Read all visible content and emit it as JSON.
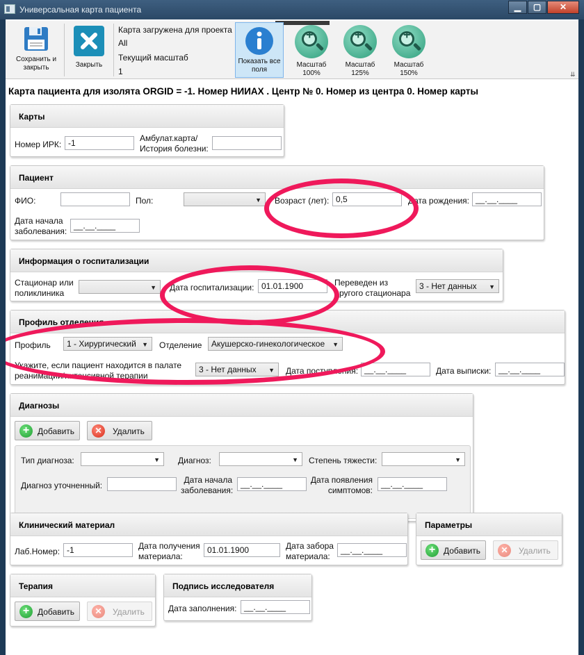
{
  "window": {
    "title": "Универсальная карта пациента",
    "min": "▁",
    "max": "▢",
    "close": "✕"
  },
  "ribbon": {
    "save": "Сохранить и закрыть",
    "close": "Закрыть",
    "info_line1": "Карта загружена для проекта",
    "info_line2": "All",
    "info_line3": "Текущий масштаб",
    "info_line4": "1",
    "show_all": "Показать все поля",
    "zoom100": "Масштаб 100%",
    "zoom125": "Масштаб 125%",
    "zoom150": "Масштаб 150%"
  },
  "heading": "Карта пациента для изолята ORGID = -1. Номер НИИАХ . Центр № 0. Номер из центра 0. Номер карты",
  "cards": {
    "title": "Карты",
    "irk_label": "Номер ИРК:",
    "irk_value": "-1",
    "ambul_label1": "Амбулат.карта/",
    "ambul_label2": "История болезни:",
    "ambul_value": ""
  },
  "patient": {
    "title": "Пациент",
    "fio_label": "ФИО:",
    "fio_value": "",
    "sex_label": "Пол:",
    "sex_value": "",
    "age_label": "Возраст (лет):",
    "age_value": "0,5",
    "dob_label": "Дата рождения:",
    "dob_value": "__.__.____",
    "onset_label1": "Дата начала",
    "onset_label2": "заболевания:",
    "onset_value": "__.__.____"
  },
  "hosp": {
    "title": "Информация о госпитализации",
    "stac_label1": "Стационар или",
    "stac_label2": "поликлиника",
    "stac_value": "",
    "date_label": "Дата госпитализации:",
    "date_value": "01.01.1900",
    "transfer_label1": "Переведен из",
    "transfer_label2": "другого стационара",
    "transfer_value": "3 - Нет данных"
  },
  "dept": {
    "title": "Профиль отделения",
    "profile_label": "Профиль",
    "profile_value": "1 - Хирургический",
    "dept_label": "Отделение",
    "dept_value": "Акушерско-гинекологическое",
    "icu_label1": "Укажите, если пациент находится в палате",
    "icu_label2": "реанимации/интенсивной терапии",
    "icu_value": "3 - Нет данных",
    "admit_label": "Дата поступления:",
    "admit_value": "__.__.____",
    "discharge_label": "Дата выписки:",
    "discharge_value": "__.__.____"
  },
  "diag": {
    "title": "Диагнозы",
    "add": "Добавить",
    "delete": "Удалить",
    "type_label": "Тип диагноза:",
    "type_value": "",
    "diag_label": "Диагноз:",
    "diag_value": "",
    "severity_label": "Степень тяжести:",
    "severity_value": "",
    "refined_label": "Диагноз уточненный:",
    "refined_value": "",
    "onset_label1": "Дата начала",
    "onset_label2": "заболевания:",
    "onset_value": "__.__.____",
    "symptoms_label1": "Дата появления",
    "symptoms_label2": "симптомов:",
    "symptoms_value": "__.__.____"
  },
  "clin": {
    "title": "Клинический материал",
    "lab_label": "Лаб.Номер:",
    "lab_value": "-1",
    "recv_label1": "Дата получения",
    "recv_label2": "материала:",
    "recv_value": "01.01.1900",
    "take_label1": "Дата забора",
    "take_label2": "материала:",
    "take_value": "__.__.____"
  },
  "params": {
    "title": "Параметры",
    "add": "Добавить",
    "delete": "Удалить"
  },
  "therapy": {
    "title": "Терапия",
    "add": "Добавить",
    "delete": "Удалить"
  },
  "signature": {
    "title": "Подпись исследователя",
    "fill_label": "Дата заполнения:",
    "fill_value": "__.__.____"
  },
  "colors": {
    "highlight": "#ef195b",
    "frame": "#2b4866"
  }
}
